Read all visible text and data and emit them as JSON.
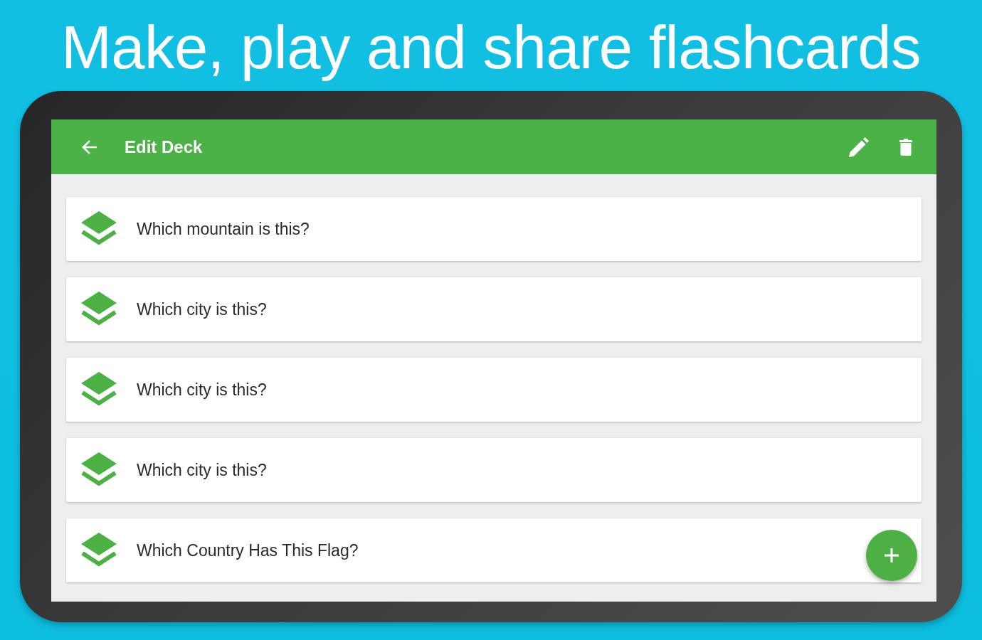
{
  "headline": "Make, play and share flashcards",
  "app_bar": {
    "title": "Edit Deck"
  },
  "cards": [
    {
      "question": "Which mountain is this?"
    },
    {
      "question": "Which city is this?"
    },
    {
      "question": "Which city is this?"
    },
    {
      "question": "Which city is this?"
    },
    {
      "question": "Which Country Has This Flag?"
    }
  ]
}
